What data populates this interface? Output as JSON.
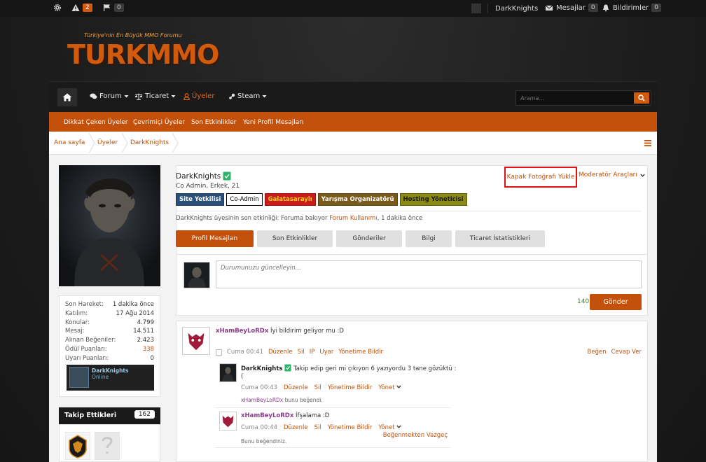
{
  "topbar": {
    "alerts_count": "2",
    "flags_count": "0",
    "username": "DarkKnights",
    "messages_label": "Mesajlar",
    "messages_count": "0",
    "notifications_label": "Bildirimler",
    "notifications_count": "0"
  },
  "logo": {
    "tagline": "Türkiye'nin En Büyük MMO Forumu",
    "text": "TURKMMO"
  },
  "nav": {
    "items": [
      {
        "label": "Forum"
      },
      {
        "label": "Ticaret"
      },
      {
        "label": "Üyeler"
      },
      {
        "label": "Steam"
      }
    ],
    "search_placeholder": "Arama..."
  },
  "subnav": {
    "items": [
      "Dikkat Çeken Üyeler",
      "Çevrimiçi Üyeler",
      "Son Etkinlikler",
      "Yeni Profil Mesajları"
    ]
  },
  "breadcrumb": [
    "Ana sayfa",
    "Üyeler",
    "DarkKnights"
  ],
  "sidebar": {
    "stats": [
      {
        "label": "Son Hareket:",
        "value": "1 dakika önce"
      },
      {
        "label": "Katılım:",
        "value": "17 Ağu 2014"
      },
      {
        "label": "Konular:",
        "value": "4.799"
      },
      {
        "label": "Mesaj:",
        "value": "14.511"
      },
      {
        "label": "Alınan Beğeniler:",
        "value": "2.423"
      },
      {
        "label": "Ödül Puanları:",
        "value": "338"
      },
      {
        "label": "Uyarı Puanları:",
        "value": "0"
      }
    ],
    "online_name": "DarkKnights",
    "online_status": "Online",
    "following_label": "Takip Ettikleri",
    "following_count": "162"
  },
  "profile": {
    "name": "DarkKnights",
    "title": "Co Admin, Erkek, 21",
    "banners": [
      {
        "label": "Site Yetkilisi",
        "bg": "#2a4f7a",
        "fg": "#ffffff"
      },
      {
        "label": "Co-Admin",
        "bg": "#ffffff",
        "fg": "#000000"
      },
      {
        "label": "Galatasaraylı",
        "bg": "#cc1b1b",
        "fg": "#f4d21a"
      },
      {
        "label": "Yarışma Organizatörü",
        "bg": "#7a5a1a",
        "fg": "#ffffff"
      },
      {
        "label": "Hosting Yöneticisi",
        "bg": "#7a7a10",
        "fg": "#1a1a1a"
      }
    ],
    "last_activity_prefix": "DarkKnights üyesinin son etkinliği: Foruma bakıyor",
    "last_activity_link": "Forum Kullanımı",
    "last_activity_suffix": ", 1 dakika önce",
    "cover_button": "Kapak Fotoğrafı Yükle",
    "mod_tools": "Moderatör Araçları",
    "tabs": [
      "Profil Mesajları",
      "Son Etkinlikler",
      "Gönderiler",
      "Bilgi",
      "Ticaret İstatistikleri"
    ]
  },
  "composer": {
    "placeholder": "Durumunuzu güncelleyin...",
    "char_count": "140",
    "send_label": "Gönder"
  },
  "post": {
    "author": "xHamBeyLoRDx",
    "text": "İyi bildirim geliyor mu :D",
    "time": "Cuma 00:41",
    "actions": [
      "Düzenle",
      "Sil",
      "IP",
      "Uyar",
      "Yönetime Bildir"
    ],
    "right_actions": [
      "Beğen",
      "Cevap Ver"
    ],
    "replies": [
      {
        "author": "DarkKnights",
        "text_line1": "Takip edip geri mi çıkıyon 6 yazıyordu 3 tane gözüktü :",
        "text_line2": "(",
        "time": "Cuma 00:43",
        "actions": [
          "Düzenle",
          "Sil",
          "Yönetime Bildir",
          "Yönet"
        ],
        "liked_user": "xHamBeyLoRDx",
        "liked_suffix": "bunu beğendi."
      },
      {
        "author": "xHamBeyLoRDx",
        "text": "İfşalama :D",
        "time": "Cuma 00:44",
        "actions": [
          "Düzenle",
          "Sil",
          "Yönetime Bildir",
          "Yönet"
        ],
        "unlike": "Beğenmekten Vazgeç",
        "liked_text": "Bunu beğendiniz."
      }
    ]
  }
}
